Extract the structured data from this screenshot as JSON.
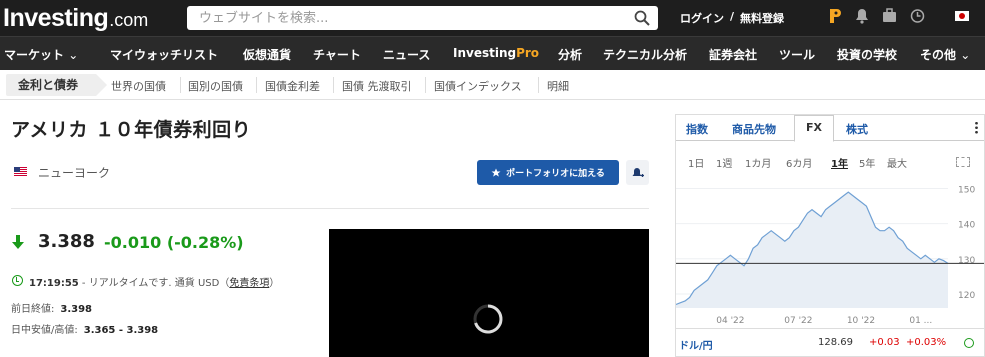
{
  "header": {
    "logo_brand": "Investing",
    "logo_tld": ".com",
    "search_placeholder": "ウェブサイトを検索...",
    "login": "ログイン",
    "separator": "/",
    "register": "無料登録"
  },
  "nav": {
    "items": [
      "マーケット",
      "マイウォッチリスト",
      "仮想通貨",
      "チャート",
      "ニュース",
      "Investing",
      "Pro",
      "分析",
      "テクニカル分析",
      "証券会社",
      "ツール",
      "投資の学校",
      "その他"
    ]
  },
  "subnav": {
    "active": "金利と債券",
    "items": [
      "世界の国債",
      "国別の国債",
      "国債金利差",
      "国債 先渡取引",
      "国債インデックス",
      "明細"
    ]
  },
  "instrument": {
    "title": "アメリカ １０年債券利回り",
    "exchange": "ニューヨーク",
    "add_portfolio": "ポートフォリオに加える",
    "price": "3.388",
    "change": "-0.010",
    "change_pct": "(-0.28%)",
    "time": "17:19:55",
    "realtime_text": " - リアルタイムです. 通貨 USD（",
    "disclaimer": "免責条項",
    "close_paren": "）",
    "prev_close_label": "前日終値:",
    "prev_close_value": "3.398",
    "day_range_label": "日中安値/高値:",
    "day_range_value": "3.365 - 3.398"
  },
  "widget": {
    "tabs": [
      "指数",
      "商品先物",
      "FX",
      "株式"
    ],
    "active_tab": "FX",
    "ranges": [
      "1日",
      "1週",
      "1カ月",
      "6カ月",
      "1年",
      "5年",
      "最大"
    ],
    "active_range": "1年",
    "pair": {
      "name": "ドル/円",
      "last": "128.69",
      "change": "+0.03",
      "change_pct": "+0.03%"
    }
  },
  "chart_data": {
    "type": "area",
    "title": "",
    "xlabel": "",
    "ylabel": "",
    "x_ticks": [
      "04 '22",
      "07 '22",
      "10 '22",
      "01 ..."
    ],
    "y_ticks": [
      120,
      130,
      140,
      150
    ],
    "ylim": [
      116,
      153
    ],
    "current_value": 128.69,
    "series": [
      {
        "values": [
          117,
          117.5,
          118,
          119,
          121,
          122,
          123,
          124,
          126,
          128,
          129,
          130,
          131,
          130,
          129,
          128,
          130,
          133,
          134,
          136,
          137,
          138,
          137,
          136,
          135,
          136,
          138,
          139,
          141,
          143,
          144,
          143,
          142,
          144,
          145,
          146,
          147,
          148,
          149,
          148,
          147,
          146,
          145,
          142,
          139,
          138,
          138,
          139,
          138,
          136,
          135,
          133,
          132,
          131,
          130,
          131,
          130,
          129,
          130,
          129.5,
          128.7
        ]
      }
    ],
    "color_line": "#6fa0d4",
    "color_fill": "#e8eef5"
  }
}
